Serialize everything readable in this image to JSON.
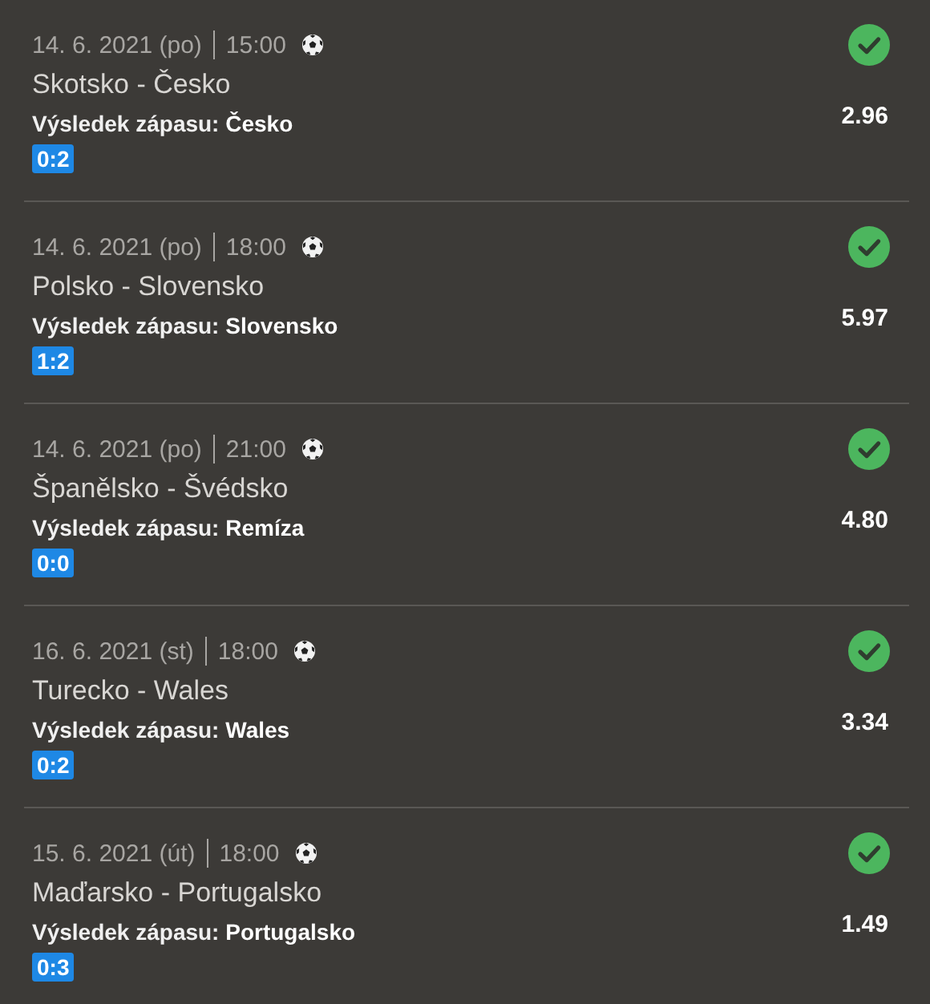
{
  "bets": [
    {
      "date": "14. 6. 2021 (po)",
      "time": "15:00",
      "match": "Skotsko - Česko",
      "bet": "Výsledek zápasu: **Česko**",
      "score": "0:2",
      "odds": "2.96",
      "won": true
    },
    {
      "date": "14. 6. 2021 (po)",
      "time": "18:00",
      "match": "Polsko - Slovensko",
      "bet": "Výsledek zápasu: **Slovensko**",
      "score": "1:2",
      "odds": "5.97",
      "won": true
    },
    {
      "date": "14. 6. 2021 (po)",
      "time": "21:00",
      "match": "Španělsko - Švédsko",
      "bet": "Výsledek zápasu: **Remíza**",
      "score": "0:0",
      "odds": "4.80",
      "won": true
    },
    {
      "date": "16. 6. 2021 (st)",
      "time": "18:00",
      "match": "Turecko - Wales",
      "bet": "Výsledek zápasu: **Wales**",
      "score": "0:2",
      "odds": "3.34",
      "won": true
    },
    {
      "date": "15. 6. 2021 (út)",
      "time": "18:00",
      "match": "Maďarsko - Portugalsko",
      "bet": "Výsledek zápasu: **Portugalsko**",
      "score": "0:3",
      "odds": "1.49",
      "won": true
    }
  ]
}
